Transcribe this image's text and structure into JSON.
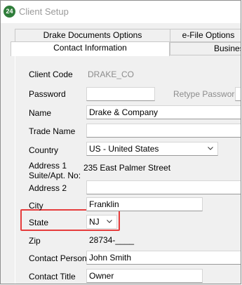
{
  "window": {
    "title": "Client Setup",
    "app_icon_text": "24"
  },
  "tabs_row1": [
    {
      "label": "Drake Documents Options"
    },
    {
      "label": "e-File Options"
    }
  ],
  "tabs_row2": [
    {
      "label": "Contact Information"
    },
    {
      "label": "Business"
    }
  ],
  "form": {
    "client_code": {
      "label": "Client Code",
      "value": "DRAKE_CO"
    },
    "password": {
      "label": "Password",
      "value": ""
    },
    "retype_password": {
      "label": "Retype Password",
      "value": ""
    },
    "name": {
      "label": "Name",
      "value": "Drake & Company"
    },
    "trade_name": {
      "label": "Trade Name",
      "value": ""
    },
    "country": {
      "label": "Country",
      "value": "US - United States"
    },
    "address1": {
      "label_line1": "Address 1",
      "label_line2": "Suite/Apt. No:",
      "value": "235 East Palmer Street"
    },
    "address2": {
      "label": "Address 2",
      "value": ""
    },
    "city": {
      "label": "City",
      "value": "Franklin"
    },
    "state": {
      "label": "State",
      "value": "NJ"
    },
    "zip": {
      "label": "Zip",
      "value": "28734-____"
    },
    "contact_person": {
      "label": "Contact Person",
      "value": "John Smith"
    },
    "contact_title": {
      "label": "Contact Title",
      "value": "Owner"
    }
  },
  "colors": {
    "highlight": "#e63c3c",
    "app_icon": "#2f7d3a"
  }
}
